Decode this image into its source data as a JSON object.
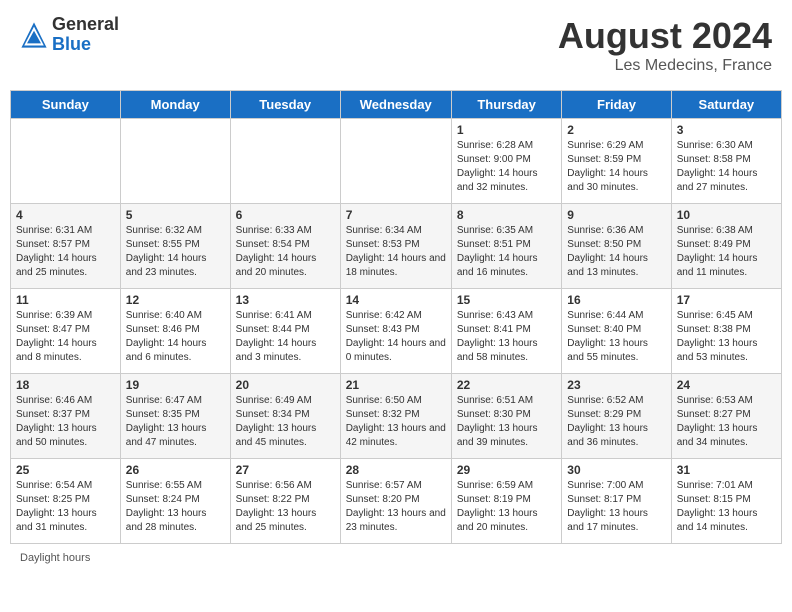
{
  "header": {
    "logo": {
      "general": "General",
      "blue": "Blue"
    },
    "title": "August 2024",
    "location": "Les Medecins, France"
  },
  "days_of_week": [
    "Sunday",
    "Monday",
    "Tuesday",
    "Wednesday",
    "Thursday",
    "Friday",
    "Saturday"
  ],
  "weeks": [
    [
      {
        "day": "",
        "info": ""
      },
      {
        "day": "",
        "info": ""
      },
      {
        "day": "",
        "info": ""
      },
      {
        "day": "",
        "info": ""
      },
      {
        "day": "1",
        "info": "Sunrise: 6:28 AM\nSunset: 9:00 PM\nDaylight: 14 hours and 32 minutes."
      },
      {
        "day": "2",
        "info": "Sunrise: 6:29 AM\nSunset: 8:59 PM\nDaylight: 14 hours and 30 minutes."
      },
      {
        "day": "3",
        "info": "Sunrise: 6:30 AM\nSunset: 8:58 PM\nDaylight: 14 hours and 27 minutes."
      }
    ],
    [
      {
        "day": "4",
        "info": "Sunrise: 6:31 AM\nSunset: 8:57 PM\nDaylight: 14 hours and 25 minutes."
      },
      {
        "day": "5",
        "info": "Sunrise: 6:32 AM\nSunset: 8:55 PM\nDaylight: 14 hours and 23 minutes."
      },
      {
        "day": "6",
        "info": "Sunrise: 6:33 AM\nSunset: 8:54 PM\nDaylight: 14 hours and 20 minutes."
      },
      {
        "day": "7",
        "info": "Sunrise: 6:34 AM\nSunset: 8:53 PM\nDaylight: 14 hours and 18 minutes."
      },
      {
        "day": "8",
        "info": "Sunrise: 6:35 AM\nSunset: 8:51 PM\nDaylight: 14 hours and 16 minutes."
      },
      {
        "day": "9",
        "info": "Sunrise: 6:36 AM\nSunset: 8:50 PM\nDaylight: 14 hours and 13 minutes."
      },
      {
        "day": "10",
        "info": "Sunrise: 6:38 AM\nSunset: 8:49 PM\nDaylight: 14 hours and 11 minutes."
      }
    ],
    [
      {
        "day": "11",
        "info": "Sunrise: 6:39 AM\nSunset: 8:47 PM\nDaylight: 14 hours and 8 minutes."
      },
      {
        "day": "12",
        "info": "Sunrise: 6:40 AM\nSunset: 8:46 PM\nDaylight: 14 hours and 6 minutes."
      },
      {
        "day": "13",
        "info": "Sunrise: 6:41 AM\nSunset: 8:44 PM\nDaylight: 14 hours and 3 minutes."
      },
      {
        "day": "14",
        "info": "Sunrise: 6:42 AM\nSunset: 8:43 PM\nDaylight: 14 hours and 0 minutes."
      },
      {
        "day": "15",
        "info": "Sunrise: 6:43 AM\nSunset: 8:41 PM\nDaylight: 13 hours and 58 minutes."
      },
      {
        "day": "16",
        "info": "Sunrise: 6:44 AM\nSunset: 8:40 PM\nDaylight: 13 hours and 55 minutes."
      },
      {
        "day": "17",
        "info": "Sunrise: 6:45 AM\nSunset: 8:38 PM\nDaylight: 13 hours and 53 minutes."
      }
    ],
    [
      {
        "day": "18",
        "info": "Sunrise: 6:46 AM\nSunset: 8:37 PM\nDaylight: 13 hours and 50 minutes."
      },
      {
        "day": "19",
        "info": "Sunrise: 6:47 AM\nSunset: 8:35 PM\nDaylight: 13 hours and 47 minutes."
      },
      {
        "day": "20",
        "info": "Sunrise: 6:49 AM\nSunset: 8:34 PM\nDaylight: 13 hours and 45 minutes."
      },
      {
        "day": "21",
        "info": "Sunrise: 6:50 AM\nSunset: 8:32 PM\nDaylight: 13 hours and 42 minutes."
      },
      {
        "day": "22",
        "info": "Sunrise: 6:51 AM\nSunset: 8:30 PM\nDaylight: 13 hours and 39 minutes."
      },
      {
        "day": "23",
        "info": "Sunrise: 6:52 AM\nSunset: 8:29 PM\nDaylight: 13 hours and 36 minutes."
      },
      {
        "day": "24",
        "info": "Sunrise: 6:53 AM\nSunset: 8:27 PM\nDaylight: 13 hours and 34 minutes."
      }
    ],
    [
      {
        "day": "25",
        "info": "Sunrise: 6:54 AM\nSunset: 8:25 PM\nDaylight: 13 hours and 31 minutes."
      },
      {
        "day": "26",
        "info": "Sunrise: 6:55 AM\nSunset: 8:24 PM\nDaylight: 13 hours and 28 minutes."
      },
      {
        "day": "27",
        "info": "Sunrise: 6:56 AM\nSunset: 8:22 PM\nDaylight: 13 hours and 25 minutes."
      },
      {
        "day": "28",
        "info": "Sunrise: 6:57 AM\nSunset: 8:20 PM\nDaylight: 13 hours and 23 minutes."
      },
      {
        "day": "29",
        "info": "Sunrise: 6:59 AM\nSunset: 8:19 PM\nDaylight: 13 hours and 20 minutes."
      },
      {
        "day": "30",
        "info": "Sunrise: 7:00 AM\nSunset: 8:17 PM\nDaylight: 13 hours and 17 minutes."
      },
      {
        "day": "31",
        "info": "Sunrise: 7:01 AM\nSunset: 8:15 PM\nDaylight: 13 hours and 14 minutes."
      }
    ]
  ],
  "footer": {
    "daylight_label": "Daylight hours"
  }
}
